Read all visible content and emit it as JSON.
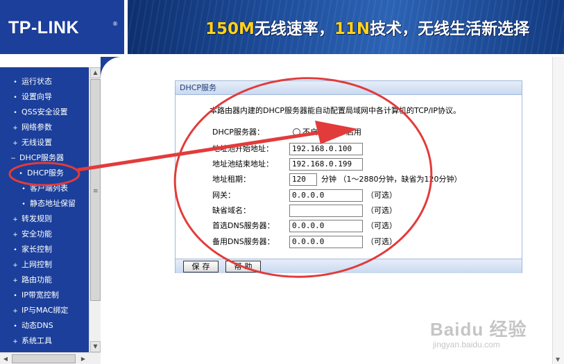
{
  "header": {
    "logo": "TP-LINK",
    "logo_mark": "®",
    "banner_part1": "150M",
    "banner_part2": "无线速率，",
    "banner_part3": "11N",
    "banner_part4": "技术，无线生活新选择"
  },
  "sidebar": {
    "items": [
      {
        "bullet": "•",
        "label": "运行状态"
      },
      {
        "bullet": "•",
        "label": "设置向导"
      },
      {
        "bullet": "•",
        "label": "QSS安全设置"
      },
      {
        "bullet": "+",
        "label": "网络参数"
      },
      {
        "bullet": "+",
        "label": "无线设置"
      },
      {
        "bullet": "−",
        "label": "DHCP服务器"
      },
      {
        "bullet": "•",
        "label": "DHCP服务"
      },
      {
        "bullet": "•",
        "label": "客户端列表"
      },
      {
        "bullet": "•",
        "label": "静态地址保留"
      },
      {
        "bullet": "+",
        "label": "转发规则"
      },
      {
        "bullet": "+",
        "label": "安全功能"
      },
      {
        "bullet": "•",
        "label": "家长控制"
      },
      {
        "bullet": "+",
        "label": "上网控制"
      },
      {
        "bullet": "+",
        "label": "路由功能"
      },
      {
        "bullet": "•",
        "label": "IP带宽控制"
      },
      {
        "bullet": "+",
        "label": "IP与MAC绑定"
      },
      {
        "bullet": "•",
        "label": "动态DNS"
      },
      {
        "bullet": "+",
        "label": "系统工具"
      }
    ]
  },
  "panel": {
    "title": "DHCP服务",
    "intro": "本路由器内建的DHCP服务器能自动配置局域网中各计算机的TCP/IP协议。",
    "dhcp_server_label": "DHCP服务器：",
    "option_off": "不启用",
    "option_on": "启用",
    "start_label": "地址池开始地址：",
    "start_value": "192.168.0.100",
    "end_label": "地址池结束地址：",
    "end_value": "192.168.0.199",
    "lease_label": "地址租期：",
    "lease_value": "120",
    "lease_hint": "分钟 （1～2880分钟，缺省为120分钟）",
    "gateway_label": "网关：",
    "gateway_value": "0.0.0.0",
    "optional": "（可选）",
    "domain_label": "缺省域名：",
    "domain_value": "",
    "dns1_label": "首选DNS服务器：",
    "dns1_value": "0.0.0.0",
    "dns2_label": "备用DNS服务器：",
    "dns2_value": "0.0.0.0",
    "save_label": "保存",
    "help_label": "帮助"
  },
  "watermark": {
    "main": "Baidu 经验",
    "sub": "jingyan.baidu.com"
  },
  "colors": {
    "sidebar_bg": "#1b3f9a",
    "annotation_red": "#e23b3b",
    "banner_yellow": "#ffd21a"
  }
}
